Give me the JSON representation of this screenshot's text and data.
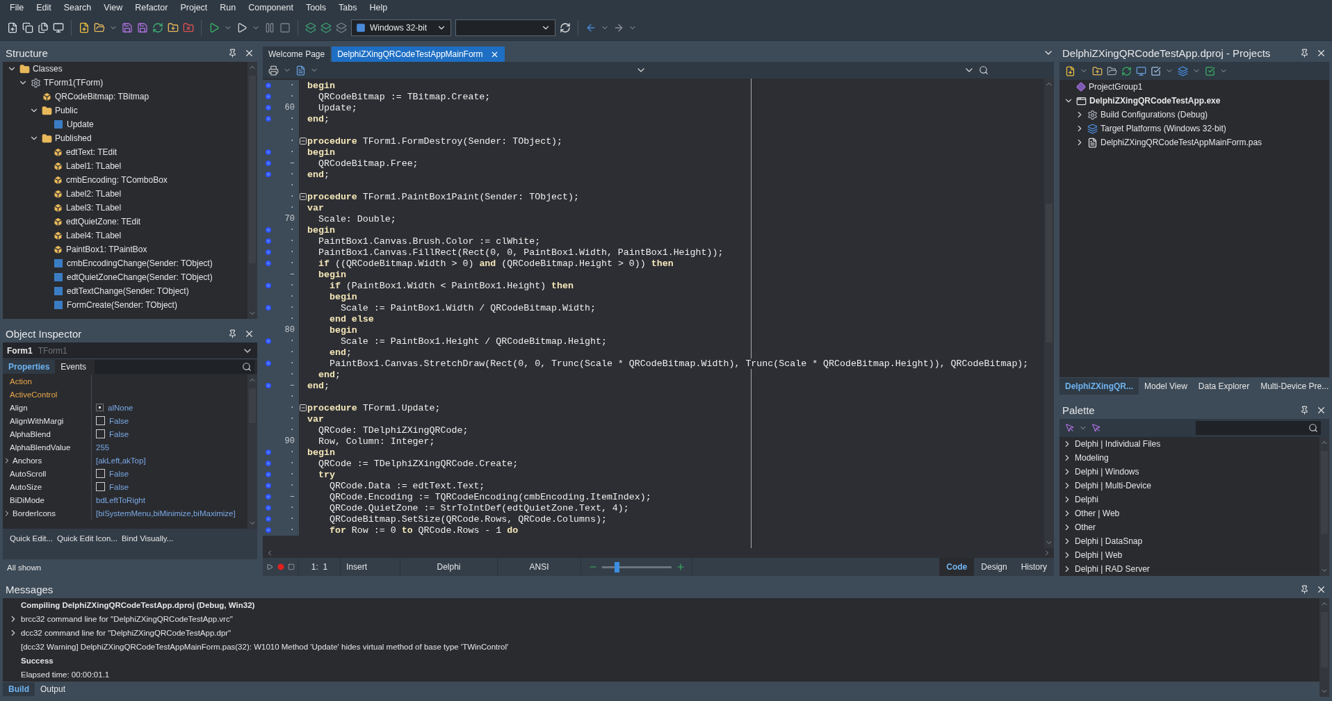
{
  "menu": [
    "File",
    "Edit",
    "Search",
    "View",
    "Refactor",
    "Project",
    "Run",
    "Component",
    "Tools",
    "Tabs",
    "Help"
  ],
  "toolbar": {
    "platform": "Windows 32-bit"
  },
  "structure": {
    "title": "Structure",
    "tree": [
      {
        "label": "Classes",
        "kind": "folder",
        "expanded": true,
        "children": [
          {
            "label": "TForm1(TForm)",
            "kind": "class",
            "expanded": true,
            "children": [
              {
                "label": "QRCodeBitmap: TBitmap",
                "kind": "field"
              },
              {
                "label": "Public",
                "kind": "folder",
                "expanded": true,
                "children": [
                  {
                    "label": "Update",
                    "kind": "method"
                  }
                ]
              },
              {
                "label": "Published",
                "kind": "folder",
                "expanded": true,
                "children": [
                  {
                    "label": "edtText: TEdit",
                    "kind": "field"
                  },
                  {
                    "label": "Label1: TLabel",
                    "kind": "field"
                  },
                  {
                    "label": "cmbEncoding: TComboBox",
                    "kind": "field"
                  },
                  {
                    "label": "Label2: TLabel",
                    "kind": "field"
                  },
                  {
                    "label": "Label3: TLabel",
                    "kind": "field"
                  },
                  {
                    "label": "edtQuietZone: TEdit",
                    "kind": "field"
                  },
                  {
                    "label": "Label4: TLabel",
                    "kind": "field"
                  },
                  {
                    "label": "PaintBox1: TPaintBox",
                    "kind": "field"
                  },
                  {
                    "label": "cmbEncodingChange(Sender: TObject)",
                    "kind": "method"
                  },
                  {
                    "label": "edtQuietZoneChange(Sender: TObject)",
                    "kind": "method"
                  },
                  {
                    "label": "edtTextChange(Sender: TObject)",
                    "kind": "method"
                  },
                  {
                    "label": "FormCreate(Sender: TObject)",
                    "kind": "method"
                  }
                ]
              }
            ]
          }
        ]
      }
    ]
  },
  "object_inspector": {
    "title": "Object Inspector",
    "object": "Form1",
    "object_type": "TForm1",
    "tabs": [
      {
        "label": "Properties",
        "selected": true
      },
      {
        "label": "Events",
        "selected": false
      }
    ],
    "properties": [
      {
        "name": "Action",
        "kind": "reference"
      },
      {
        "name": "ActiveControl",
        "kind": "reference"
      },
      {
        "name": "Align",
        "kind": "align",
        "value": "alNone"
      },
      {
        "name": "AlignWithMargi",
        "kind": "checkbox",
        "checked": false,
        "value": "False"
      },
      {
        "name": "AlphaBlend",
        "kind": "checkbox",
        "checked": false,
        "value": "False"
      },
      {
        "name": "AlphaBlendValue",
        "kind": "text",
        "value": "255"
      },
      {
        "name": "Anchors",
        "kind": "text",
        "expanded": false,
        "value": "[akLeft,akTop]"
      },
      {
        "name": "AutoScroll",
        "kind": "checkbox",
        "checked": false,
        "value": "False"
      },
      {
        "name": "AutoSize",
        "kind": "checkbox",
        "checked": false,
        "value": "False"
      },
      {
        "name": "BiDiMode",
        "kind": "text",
        "value": "bdLeftToRight"
      },
      {
        "name": "BorderIcons",
        "kind": "text",
        "expanded": false,
        "value": "[biSystemMenu,biMinimize,biMaximize]"
      }
    ],
    "actions": [
      "Quick Edit...",
      "Quick Edit Icon...",
      "Bind Visually..."
    ],
    "status": "All shown"
  },
  "editor": {
    "tabs": [
      {
        "label": "Welcome Page",
        "selected": false
      },
      {
        "label": "DelphiZXingQRCodeTestAppMainForm",
        "selected": true
      }
    ],
    "lines": [
      {
        "n": "·",
        "bp": true,
        "code": "**begin**"
      },
      {
        "n": "·",
        "bp": true,
        "code": "  QRCodeBitmap := TBitmap.Create;"
      },
      {
        "n": "60",
        "bp": true,
        "code": "  Update;"
      },
      {
        "n": "·",
        "bp": true,
        "code": "**end**;"
      },
      {
        "n": "·",
        "bp": false
      },
      {
        "n": "·",
        "bp": false,
        "fold": true,
        "code": "**procedure** TForm1.FormDestroy(Sender: TObject);"
      },
      {
        "n": "·",
        "bp": true,
        "code": "**begin**"
      },
      {
        "n": "–",
        "bp": true,
        "code": "  QRCodeBitmap.Free;"
      },
      {
        "n": "·",
        "bp": true,
        "code": "**end**;"
      },
      {
        "n": "·",
        "bp": false
      },
      {
        "n": "·",
        "bp": false,
        "fold": true,
        "code": "**procedure** TForm1.PaintBox1Paint(Sender: TObject);"
      },
      {
        "n": "·",
        "bp": false,
        "code": "**var**"
      },
      {
        "n": "70",
        "bp": false,
        "code": "  Scale: Double;"
      },
      {
        "n": "·",
        "bp": true,
        "code": "**begin**"
      },
      {
        "n": "·",
        "bp": true,
        "code": "  PaintBox1.Canvas.Brush.Color := clWhite;"
      },
      {
        "n": "·",
        "bp": true,
        "code": "  PaintBox1.Canvas.FillRect(Rect(0, 0, PaintBox1.Width, PaintBox1.Height));"
      },
      {
        "n": "·",
        "bp": true,
        "code": "  **if** ((QRCodeBitmap.Width > 0) **and** (QRCodeBitmap.Height > 0)) **then**"
      },
      {
        "n": "–",
        "bp": false,
        "code": "  **begin**"
      },
      {
        "n": "·",
        "bp": true,
        "code": "    **if** (PaintBox1.Width < PaintBox1.Height) **then**"
      },
      {
        "n": "·",
        "bp": false,
        "code": "    **begin**"
      },
      {
        "n": "·",
        "bp": true,
        "code": "      Scale := PaintBox1.Width / QRCodeBitmap.Width;"
      },
      {
        "n": "·",
        "bp": false,
        "code": "    **end else**"
      },
      {
        "n": "80",
        "bp": false,
        "code": "    **begin**"
      },
      {
        "n": "·",
        "bp": true,
        "code": "      Scale := PaintBox1.Height / QRCodeBitmap.Height;"
      },
      {
        "n": "·",
        "bp": false,
        "code": "    **end**;"
      },
      {
        "n": "·",
        "bp": true,
        "code": "    PaintBox1.Canvas.StretchDraw(Rect(0, 0, Trunc(Scale * QRCodeBitmap.Width), Trunc(Scale * QRCodeBitmap.Height)), QRCodeBitmap);"
      },
      {
        "n": "·",
        "bp": false,
        "code": "  **end**;"
      },
      {
        "n": "–",
        "bp": true,
        "code": "**end**;"
      },
      {
        "n": "·",
        "bp": false
      },
      {
        "n": "·",
        "bp": false,
        "fold": true,
        "code": "**procedure** TForm1.Update;"
      },
      {
        "n": "·",
        "bp": false,
        "code": "**var**"
      },
      {
        "n": "·",
        "bp": false,
        "code": "  QRCode: TDelphiZXingQRCode;"
      },
      {
        "n": "90",
        "bp": false,
        "code": "  Row, Column: Integer;"
      },
      {
        "n": "·",
        "bp": true,
        "code": "**begin**"
      },
      {
        "n": "·",
        "bp": true,
        "code": "  QRCode := TDelphiZXingQRCode.Create;"
      },
      {
        "n": "·",
        "bp": true,
        "code": "  **try**"
      },
      {
        "n": "·",
        "bp": true,
        "code": "    QRCode.Data := edtText.Text;"
      },
      {
        "n": "–",
        "bp": true,
        "code": "    QRCode.Encoding := TQRCodeEncoding(cmbEncoding.ItemIndex);"
      },
      {
        "n": "·",
        "bp": true,
        "code": "    QRCode.QuietZone := StrToIntDef(edtQuietZone.Text, 4);"
      },
      {
        "n": "·",
        "bp": true,
        "code": "    QRCodeBitmap.SetSize(QRCode.Rows, QRCode.Columns);"
      },
      {
        "n": "·",
        "bp": true,
        "code": "    **for** Row := 0 **to** QRCode.Rows - 1 **do**"
      }
    ],
    "status": {
      "position": "1:  1",
      "mode": "Insert",
      "language": "Delphi",
      "encoding": "ANSI",
      "zoom": {
        "level": 0.2
      },
      "views": [
        {
          "label": "Code",
          "selected": true
        },
        {
          "label": "Design",
          "selected": false
        },
        {
          "label": "History",
          "selected": false
        }
      ]
    }
  },
  "projects": {
    "title": "DelphiZXingQRCodeTestApp.dproj - Projects",
    "tree": [
      {
        "label": "ProjectGroup1",
        "kind": "group"
      },
      {
        "label": "DelphiZXingQRCodeTestApp.exe",
        "kind": "exe",
        "expanded": true,
        "children": [
          {
            "label": "Build Configurations (Debug)",
            "kind": "config",
            "expanded": false
          },
          {
            "label": "Target Platforms (Windows 32-bit)",
            "kind": "platforms",
            "expanded": false
          },
          {
            "label": "DelphiZXingQRCodeTestAppMainForm.pas",
            "kind": "file",
            "expanded": false
          }
        ]
      }
    ],
    "tabs": [
      {
        "label": "DelphiZXingQR...",
        "selected": true
      },
      {
        "label": "Model View",
        "selected": false
      },
      {
        "label": "Data Explorer",
        "selected": false
      },
      {
        "label": "Multi-Device Pre...",
        "selected": false
      }
    ]
  },
  "palette": {
    "title": "Palette",
    "items": [
      {
        "label": "Delphi | Individual Files",
        "expanded": false
      },
      {
        "label": "Modeling",
        "expanded": false
      },
      {
        "label": "Delphi | Windows",
        "expanded": false
      },
      {
        "label": "Delphi | Multi-Device",
        "expanded": false
      },
      {
        "label": "Delphi",
        "expanded": false
      },
      {
        "label": "Other | Web",
        "expanded": false
      },
      {
        "label": "Other",
        "expanded": false
      },
      {
        "label": "Delphi | DataSnap",
        "expanded": false
      },
      {
        "label": "Delphi | Web",
        "expanded": false
      },
      {
        "label": "Delphi | RAD Server",
        "expanded": false
      }
    ]
  },
  "messages": {
    "title": "Messages",
    "lines": [
      {
        "kind": "header",
        "text": "Compiling DelphiZXingQRCodeTestApp.dproj (Debug, Win32)"
      },
      {
        "kind": "group",
        "expanded": false,
        "text": "brcc32 command line for \"DelphiZXingQRCodeTestApp.vrc\""
      },
      {
        "kind": "group",
        "expanded": false,
        "text": "dcc32 command line for \"DelphiZXingQRCodeTestApp.dpr\""
      },
      {
        "kind": "line",
        "text": "[dcc32 Warning] DelphiZXingQRCodeTestAppMainForm.pas(32): W1010 Method 'Update' hides virtual method of base type 'TWinControl'"
      },
      {
        "kind": "header",
        "text": "Success"
      },
      {
        "kind": "line",
        "text": "Elapsed time: 00:00:01.1"
      }
    ],
    "tabs": [
      {
        "label": "Build",
        "selected": true
      },
      {
        "label": "Output",
        "selected": false
      }
    ]
  }
}
